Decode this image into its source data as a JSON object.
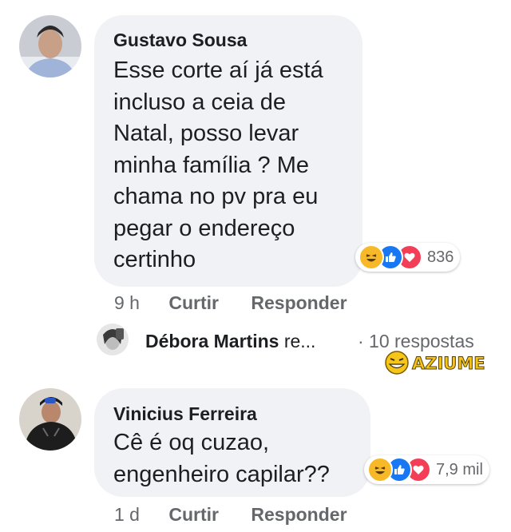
{
  "comments": [
    {
      "author": "Gustavo Sousa",
      "text": "Esse corte aí já está\nincluso a ceia de\nNatal, posso levar\nminha família ? Me\nchama no pv pra eu\npegar o endereço\ncertinho",
      "reaction_count": "836",
      "reaction_icons": [
        "haha-icon",
        "like-icon",
        "love-icon"
      ],
      "time": "9 h",
      "like_label": "Curtir",
      "reply_label": "Responder"
    },
    {
      "author": "Vinicius Ferreira",
      "text": "Cê é oq cuzao,\nengenheiro capilar??",
      "reaction_count": "7,9 mil",
      "reaction_icons": [
        "haha-icon",
        "like-icon",
        "love-icon"
      ],
      "time": "1 d",
      "like_label": "Curtir",
      "reply_label": "Responder"
    }
  ],
  "reply_thread": {
    "name": "Débora Martins",
    "suffix": " re...",
    "count_label": "· 10 respostas"
  },
  "watermark": {
    "text": "AZIUME"
  },
  "colors": {
    "bubble": "#f0f2f5",
    "text": "#1c1e21",
    "meta": "#65676b",
    "like_blue": "#1877f2",
    "love_red": "#f33e58",
    "haha_yellow": "#f7b928",
    "watermark_yellow": "#f5c518"
  }
}
